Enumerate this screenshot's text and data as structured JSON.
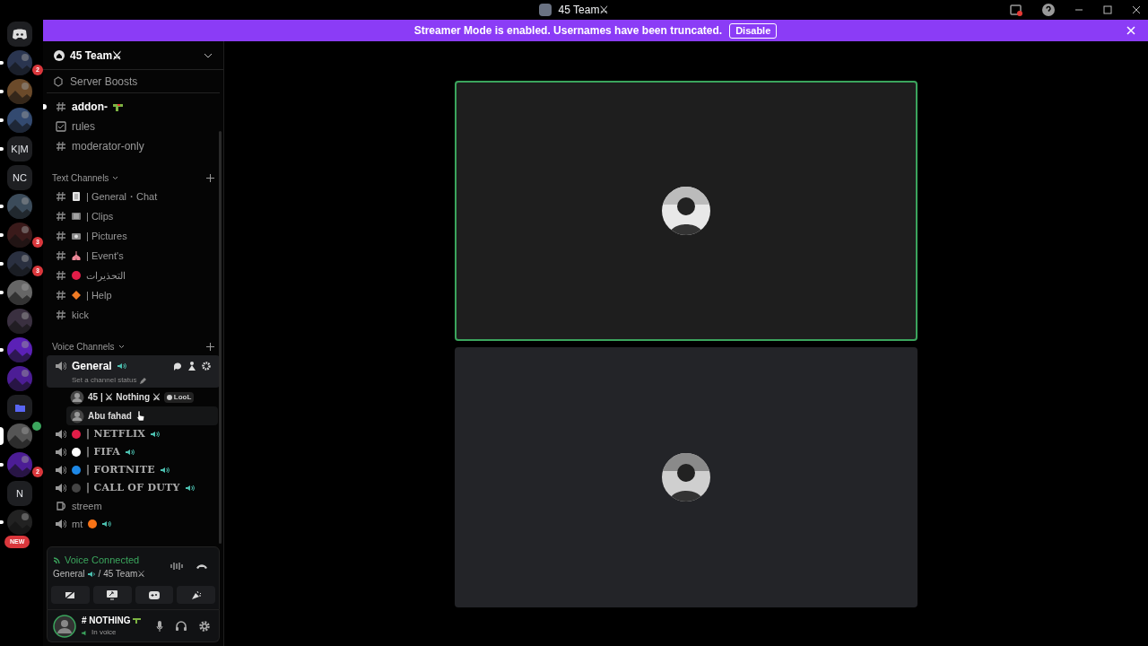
{
  "window": {
    "title": "45 Team⚔"
  },
  "banner": {
    "text": "Streamer Mode is enabled. Usernames have been truncated.",
    "button": "Disable"
  },
  "servers": [
    {
      "kind": "home",
      "selected": false,
      "unread": false,
      "in_voice": false
    },
    {
      "kind": "picture",
      "badge": "2",
      "selected": false,
      "unread": true,
      "in_voice": false
    },
    {
      "kind": "picture",
      "selected": false,
      "unread": true,
      "in_voice": false
    },
    {
      "kind": "picture",
      "selected": false,
      "unread": true,
      "in_voice": false
    },
    {
      "kind": "text",
      "label": "K|M",
      "selected": false,
      "unread": true,
      "in_voice": false
    },
    {
      "kind": "text",
      "label": "NC",
      "selected": false,
      "unread": false,
      "in_voice": false
    },
    {
      "kind": "picture",
      "selected": false,
      "unread": true,
      "in_voice": false
    },
    {
      "kind": "picture",
      "badge": "3",
      "selected": false,
      "unread": true,
      "in_voice": false
    },
    {
      "kind": "picture",
      "badge": "3",
      "selected": false,
      "unread": true,
      "in_voice": false
    },
    {
      "kind": "picture",
      "selected": false,
      "unread": true,
      "in_voice": false
    },
    {
      "kind": "picture",
      "selected": false,
      "unread": false,
      "in_voice": false
    },
    {
      "kind": "picture",
      "selected": false,
      "unread": true,
      "in_voice": false
    },
    {
      "kind": "picture",
      "selected": false,
      "unread": false,
      "in_voice": false
    },
    {
      "kind": "folder",
      "selected": false,
      "unread": false,
      "in_voice": false
    },
    {
      "kind": "picture",
      "selected": true,
      "unread": false,
      "in_voice": true
    },
    {
      "kind": "picture",
      "badge": "2",
      "selected": false,
      "unread": true,
      "in_voice": false
    },
    {
      "kind": "text",
      "label": "N",
      "selected": false,
      "unread": false,
      "in_voice": false
    },
    {
      "kind": "picture",
      "pill": "NEW",
      "selected": false,
      "unread": true,
      "in_voice": false
    }
  ],
  "server": {
    "name": "45 Team⚔",
    "boosts": "Server Boosts"
  },
  "top_channels": [
    {
      "kind": "text",
      "name": "addon-",
      "unread": true
    },
    {
      "kind": "rules",
      "name": "rules",
      "unread": false
    },
    {
      "kind": "text",
      "name": "moderator-only",
      "unread": false
    }
  ],
  "text_category": {
    "name": "Text Channels",
    "channels": [
      {
        "name": "| General・Chat"
      },
      {
        "name": "| Clips"
      },
      {
        "name": "| Pictures"
      },
      {
        "name": "| Event's"
      },
      {
        "name": "التحذيرات",
        "color": "#e11d48"
      },
      {
        "name": "| Help"
      },
      {
        "name": "kick"
      }
    ]
  },
  "voice_category": {
    "name": "Voice Channels",
    "channels": [
      {
        "kind": "voice",
        "name": "General",
        "active": true,
        "selected": true,
        "status": "Set a channel status",
        "members": [
          {
            "name": "45 | ⚔ Nothing ⚔",
            "tag": "LooL",
            "hovered": false
          },
          {
            "name": "Abu fahad",
            "hovered": true
          }
        ]
      },
      {
        "kind": "voice",
        "name": "| NETFLIX",
        "color": "#e11d48",
        "active": true,
        "selected": false
      },
      {
        "kind": "voice",
        "name": "| FIFA",
        "color": "#ffffff",
        "active": true,
        "selected": false
      },
      {
        "kind": "voice",
        "name": "| FORTNITE",
        "color": "#1e88e5",
        "active": true,
        "selected": false
      },
      {
        "kind": "voice",
        "name": "| CALL OF DUTY",
        "color": "#444444",
        "active": true,
        "selected": false
      },
      {
        "kind": "stage",
        "name": "streem",
        "active": false,
        "selected": false
      },
      {
        "kind": "suffixed",
        "name": "mt",
        "color": "#f97316",
        "active": true,
        "selected": false
      }
    ]
  },
  "voice_panel": {
    "status": "Voice Connected",
    "channel": "General",
    "server": "/ 45 Team⚔"
  },
  "user": {
    "name": "# NOTHING",
    "status": "In voice"
  },
  "tiles": [
    {
      "speaking": true
    },
    {
      "speaking": false
    }
  ]
}
